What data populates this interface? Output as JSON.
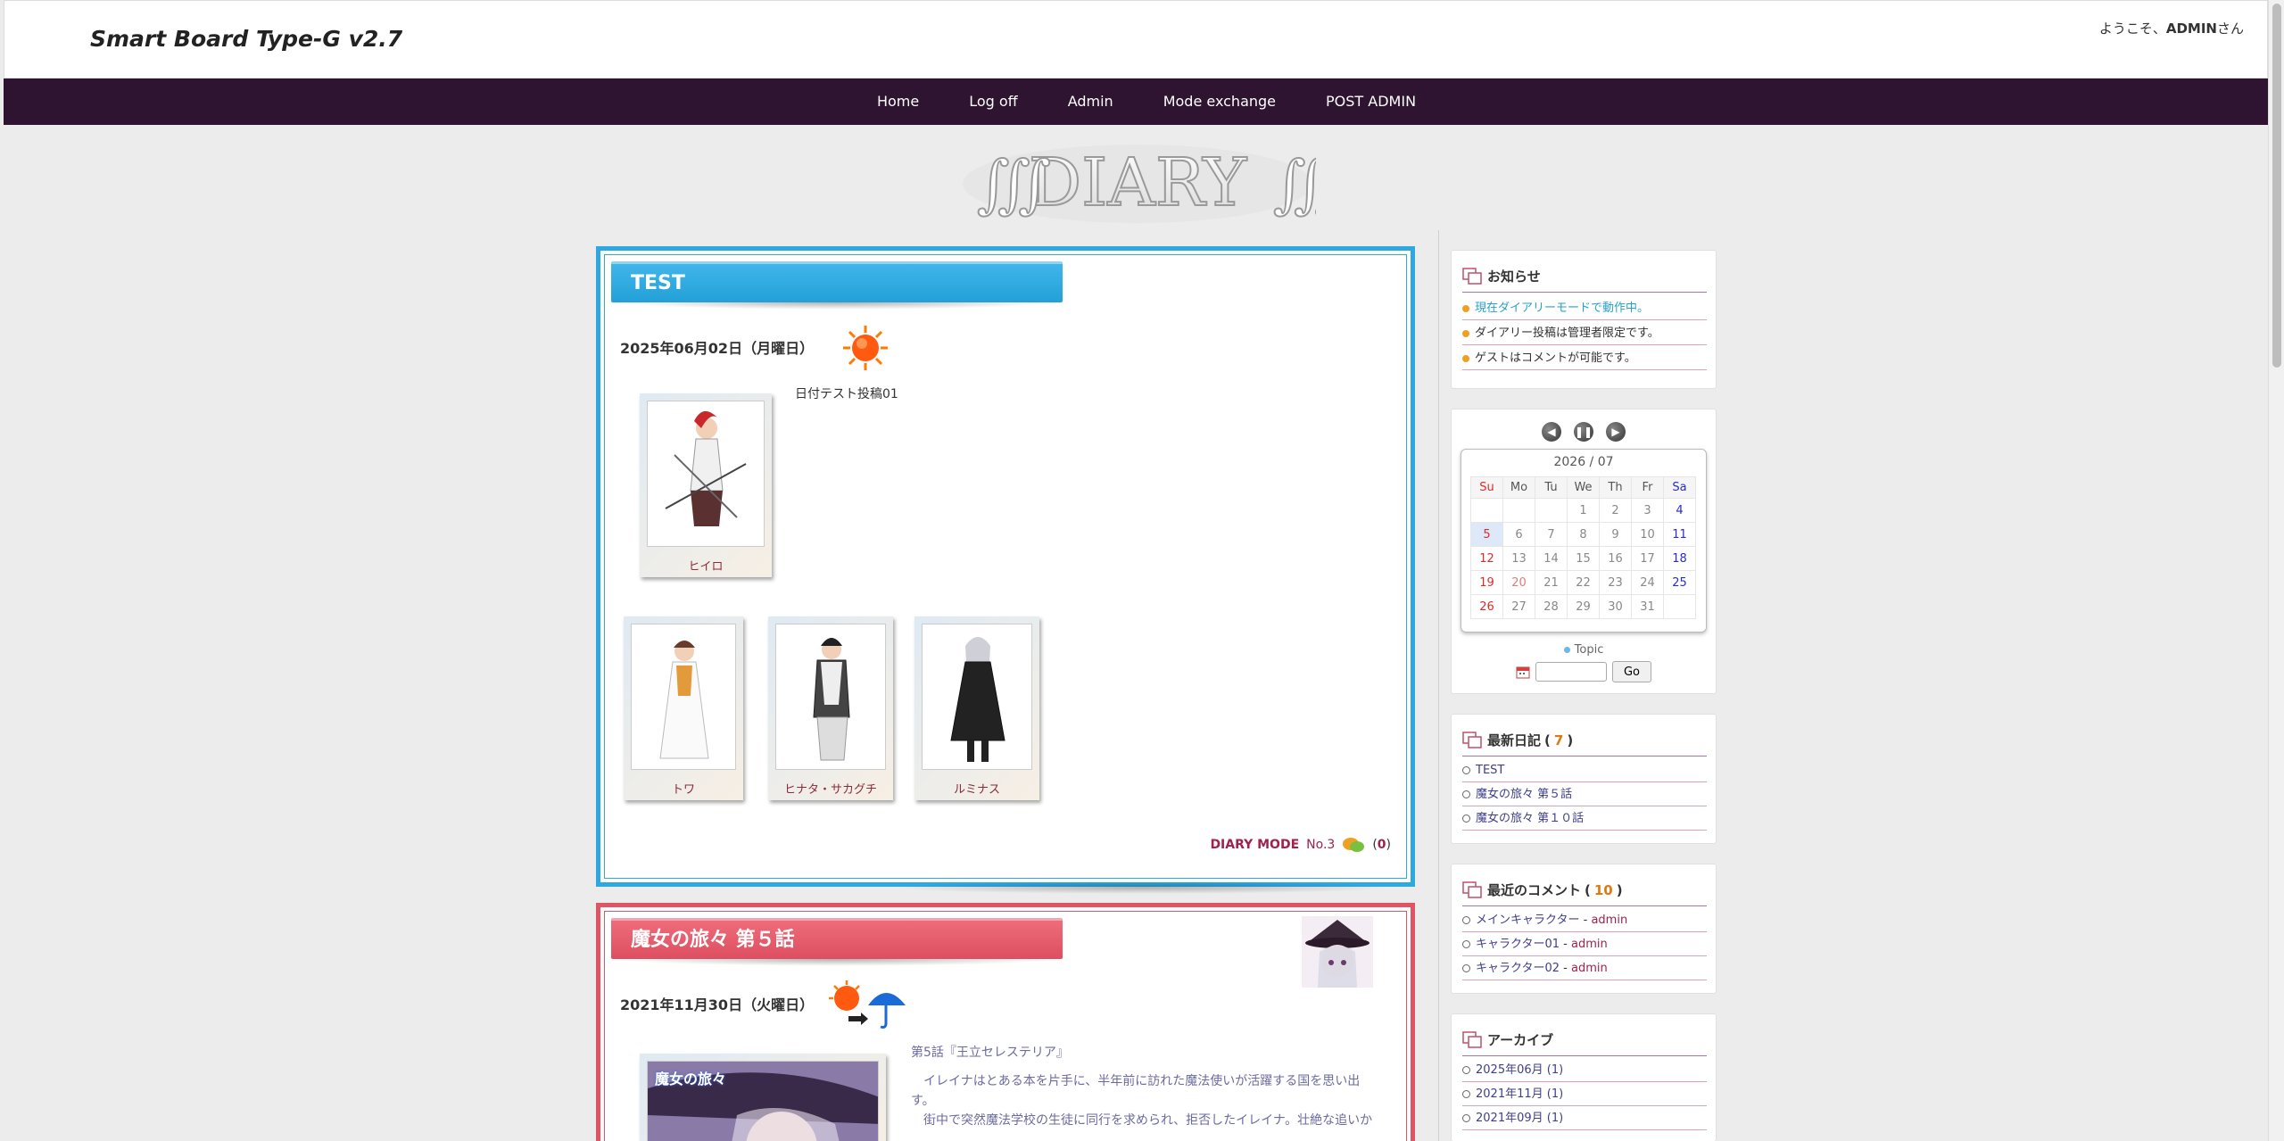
{
  "header": {
    "site_title": "Smart Board Type-G v2.7",
    "welcome_prefix": "ようこそ、",
    "welcome_user": "ADMIN",
    "welcome_suffix": "さん"
  },
  "nav": {
    "items": [
      "Home",
      "Log off",
      "Admin",
      "Mode exchange",
      "POST ADMIN"
    ]
  },
  "logo": {
    "text": "DIARY"
  },
  "articles": [
    {
      "title": "TEST",
      "date": "2025年06月02日（月曜日）",
      "weather": "sun-icon",
      "text": "日付テスト投稿01",
      "photos": [
        {
          "caption": "ヒイロ"
        },
        {
          "caption": "トワ"
        },
        {
          "caption": "ヒナタ・サカグチ"
        },
        {
          "caption": "ルミナス"
        }
      ],
      "footer": {
        "mode": "DIARY MODE",
        "number": "No.3",
        "comments_open": "(",
        "comments_count": "0",
        "comments_close": ")"
      }
    },
    {
      "title": "魔女の旅々 第５話",
      "date": "2021年11月30日（火曜日）",
      "weather": "sun-to-rain-icon",
      "photo_caption": "魔女の旅々",
      "text_lines": [
        "第5話『王立セレステリア』",
        "　イレイナはとある本を片手に、半年前に訪れた魔法使いが活躍する国を思い出",
        "す。",
        "　街中で突然魔法学校の生徒に同行を求められ、拒否したイレイナ。壮絶な追いか"
      ]
    }
  ],
  "sidebar": {
    "notice": {
      "title": "お知らせ",
      "items": [
        "現在ダイアリーモードで動作中。",
        "ダイアリー投稿は管理者限定です。",
        "ゲストはコメントが可能です。"
      ]
    },
    "calendar": {
      "month_label": "2026 / 07",
      "weekdays": [
        "Su",
        "Mo",
        "Tu",
        "We",
        "Th",
        "Fr",
        "Sa"
      ],
      "weeks": [
        [
          "",
          "",
          "",
          "1",
          "2",
          "3",
          "4"
        ],
        [
          "5",
          "6",
          "7",
          "8",
          "9",
          "10",
          "11"
        ],
        [
          "12",
          "13",
          "14",
          "15",
          "16",
          "17",
          "18"
        ],
        [
          "19",
          "20",
          "21",
          "22",
          "23",
          "24",
          "25"
        ],
        [
          "26",
          "27",
          "28",
          "29",
          "30",
          "31",
          ""
        ]
      ],
      "today": "5",
      "holidays": [
        "20"
      ],
      "topic_label": "Topic",
      "go_label": "Go",
      "date_input_value": ""
    },
    "recent_diary": {
      "title": "最新日記",
      "open": "( ",
      "count": "7",
      "close": " )",
      "items": [
        "TEST",
        "魔女の旅々 第５話",
        "魔女の旅々 第１０話"
      ]
    },
    "recent_comments": {
      "title": "最近のコメント",
      "open": "( ",
      "count": "10",
      "close": " )",
      "items": [
        {
          "subject": "メインキャラクター",
          "sep": " - ",
          "author": "admin"
        },
        {
          "subject": "キャラクター01",
          "sep": " - ",
          "author": "admin"
        },
        {
          "subject": "キャラクター02",
          "sep": " - ",
          "author": "admin"
        }
      ]
    },
    "archive": {
      "title": "アーカイブ",
      "items": [
        "2025年06月 (1)",
        "2021年11月 (1)",
        "2021年09月 (1)"
      ]
    }
  },
  "colors": {
    "nav_bg": "#2e1430",
    "article1_border": "#2ea8e0",
    "article2_border": "#e05565",
    "link": "#3e3e8e",
    "accent": "#a0224a"
  }
}
